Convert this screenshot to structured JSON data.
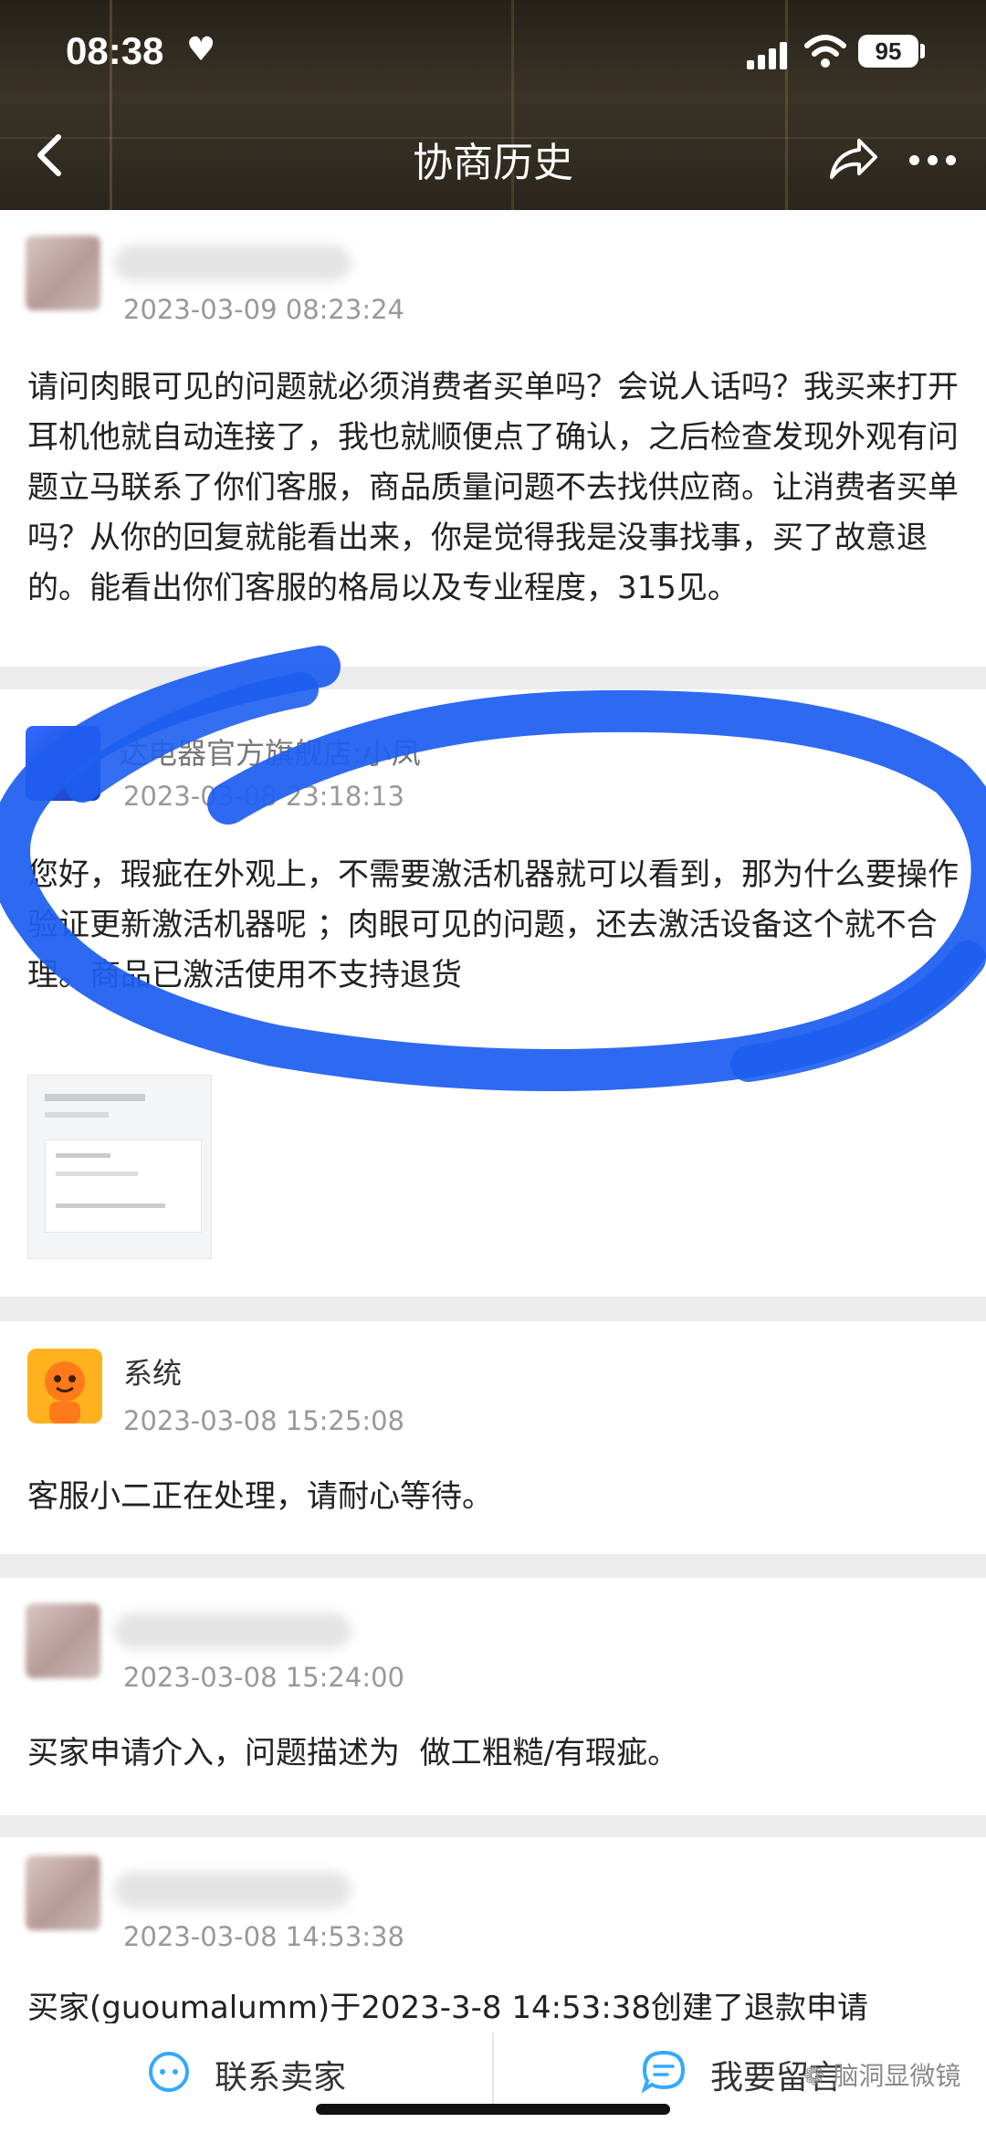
{
  "status_bar": {
    "time": "08:38",
    "heart": "♥",
    "battery": "95"
  },
  "nav": {
    "title": "协商历史",
    "back_icon": "chevron-left-icon",
    "share_icon": "share-icon",
    "more_icon": "more-icon"
  },
  "entries": [
    {
      "name": "",
      "time": "2023-03-09 08:23:24",
      "text": "请问肉眼可见的问题就必须消费者买单吗？会说人话吗？我买来打开耳机他就自动连接了，我也就顺便点了确认，之后检查发现外观有问题立马联系了你们客服，商品质量问题不去找供应商。让消费者买单吗？从你的回复就能看出来，你是觉得我是没事找事，买了故意退的。能看出你们客服的格局以及专业程度，315见。"
    },
    {
      "name": "达电器官方旗舰店:小凤",
      "time": "2023-03-08 23:18:13",
      "text": "您好，瑕疵在外观上，不需要激活机器就可以看到，那为什么要操作验证更新激活机器呢 ；肉眼可见的问题，还去激活设备这个就不合理。商品已激活使用不支持退货"
    },
    {
      "name": "系统",
      "time": "2023-03-08 15:25:08",
      "text": "客服小二正在处理，请耐心等待。"
    },
    {
      "name": "",
      "time": "2023-03-08 15:24:00",
      "text": "买家申请介入，问题描述为  做工粗糙/有瑕疵。"
    },
    {
      "name": "",
      "time": "2023-03-08 14:53:38",
      "text": "买家(guoumalumm)于2023-3-8 14:53:38创建了退款申请"
    }
  ],
  "bottom_bar": {
    "contact_seller": "联系卖家",
    "leave_message": "我要留言",
    "contact_icon": "chat-bubble-icon",
    "message_icon": "message-icon"
  },
  "watermark": "脑洞显微镜",
  "colors": {
    "accent_blue": "#1f59e6",
    "scribble": "#1e5ef0",
    "system_avatar": "#ffb21e",
    "bottom_icon": "#33aaff"
  }
}
